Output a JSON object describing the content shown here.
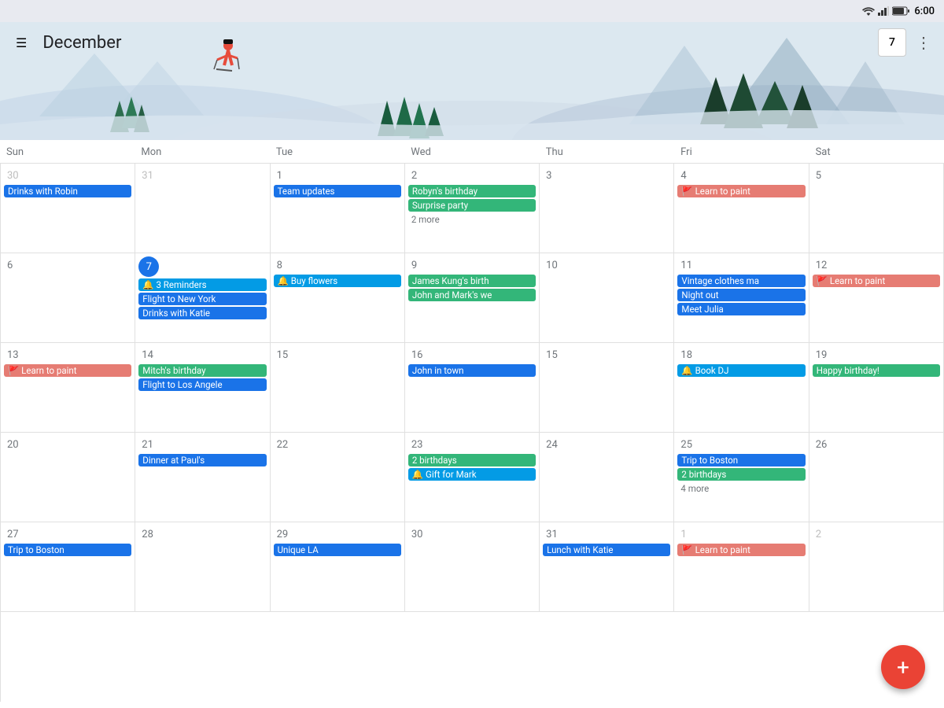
{
  "statusBar": {
    "time": "6:00"
  },
  "header": {
    "menuLabel": "☰",
    "monthTitle": "December",
    "todayDate": "7",
    "moreLabel": "⋮"
  },
  "dayHeaders": [
    "Sun",
    "Mon",
    "Tue",
    "Wed",
    "Thu",
    "Fri",
    "Sat"
  ],
  "calendar": {
    "weeks": [
      {
        "days": [
          {
            "date": "30",
            "otherMonth": true,
            "events": [
              {
                "label": "Drinks with Robin",
                "color": "blue"
              }
            ]
          },
          {
            "date": "31",
            "otherMonth": true,
            "events": []
          },
          {
            "date": "1",
            "events": [
              {
                "label": "Team updates",
                "color": "blue"
              }
            ]
          },
          {
            "date": "2",
            "events": [
              {
                "label": "Robyn's birthday",
                "color": "green"
              },
              {
                "label": "Surprise party",
                "color": "green"
              },
              {
                "label": "2 more",
                "type": "more"
              }
            ]
          },
          {
            "date": "3",
            "events": []
          },
          {
            "date": "4",
            "events": [
              {
                "label": "🚩 Learn to paint",
                "color": "orange"
              }
            ]
          },
          {
            "date": "5",
            "events": []
          }
        ]
      },
      {
        "days": [
          {
            "date": "6",
            "events": []
          },
          {
            "date": "7",
            "today": true,
            "events": [
              {
                "label": "🔔 3 Reminders",
                "color": "cyan"
              },
              {
                "label": "Flight to New York",
                "color": "blue"
              },
              {
                "label": "Drinks with Katie",
                "color": "blue"
              }
            ]
          },
          {
            "date": "8",
            "events": [
              {
                "label": "🔔 Buy flowers",
                "color": "cyan"
              }
            ]
          },
          {
            "date": "9",
            "events": [
              {
                "label": "James Kung's birth",
                "color": "green"
              },
              {
                "label": "John and Mark's we",
                "color": "green"
              }
            ]
          },
          {
            "date": "10",
            "events": []
          },
          {
            "date": "11",
            "events": [
              {
                "label": "Vintage clothes ma",
                "color": "blue"
              },
              {
                "label": "Night out",
                "color": "blue"
              },
              {
                "label": "Meet Julia",
                "color": "blue"
              }
            ]
          },
          {
            "date": "12",
            "events": [
              {
                "label": "🚩 Learn to paint",
                "color": "orange"
              }
            ]
          }
        ]
      },
      {
        "days": [
          {
            "date": "13",
            "events": [
              {
                "label": "🚩 Learn to paint",
                "color": "orange"
              }
            ]
          },
          {
            "date": "14",
            "events": [
              {
                "label": "Mitch's birthday",
                "color": "green"
              },
              {
                "label": "Flight to Los Angele",
                "color": "blue"
              }
            ]
          },
          {
            "date": "15",
            "events": []
          },
          {
            "date": "16",
            "events": [
              {
                "label": "John in town",
                "color": "blue"
              }
            ]
          },
          {
            "date": "15",
            "events": []
          },
          {
            "date": "18",
            "events": [
              {
                "label": "🔔 Book DJ",
                "color": "cyan"
              }
            ]
          },
          {
            "date": "19",
            "events": [
              {
                "label": "Happy birthday!",
                "color": "green"
              }
            ]
          }
        ]
      },
      {
        "days": [
          {
            "date": "20",
            "events": []
          },
          {
            "date": "21",
            "events": [
              {
                "label": "Dinner at Paul's",
                "color": "blue"
              }
            ]
          },
          {
            "date": "22",
            "events": []
          },
          {
            "date": "23",
            "events": [
              {
                "label": "2 birthdays",
                "color": "green"
              },
              {
                "label": "🔔 Gift for Mark",
                "color": "cyan"
              }
            ]
          },
          {
            "date": "24",
            "events": []
          },
          {
            "date": "25",
            "events": [
              {
                "label": "Trip to Boston",
                "color": "blue"
              },
              {
                "label": "2 birthdays",
                "color": "green"
              },
              {
                "label": "4 more",
                "type": "more"
              }
            ]
          },
          {
            "date": "26",
            "events": []
          }
        ]
      },
      {
        "days": [
          {
            "date": "27",
            "events": [
              {
                "label": "Trip to Boston",
                "color": "blue"
              }
            ]
          },
          {
            "date": "28",
            "events": []
          },
          {
            "date": "29",
            "events": [
              {
                "label": "Unique LA",
                "color": "blue"
              }
            ]
          },
          {
            "date": "30",
            "events": []
          },
          {
            "date": "31",
            "events": [
              {
                "label": "Lunch with Katie",
                "color": "blue"
              }
            ]
          },
          {
            "date": "1",
            "otherMonth": true,
            "events": [
              {
                "label": "🚩 Learn to paint",
                "color": "orange"
              }
            ]
          },
          {
            "date": "2",
            "otherMonth": true,
            "events": []
          }
        ]
      }
    ]
  },
  "fab": {
    "label": "+"
  }
}
